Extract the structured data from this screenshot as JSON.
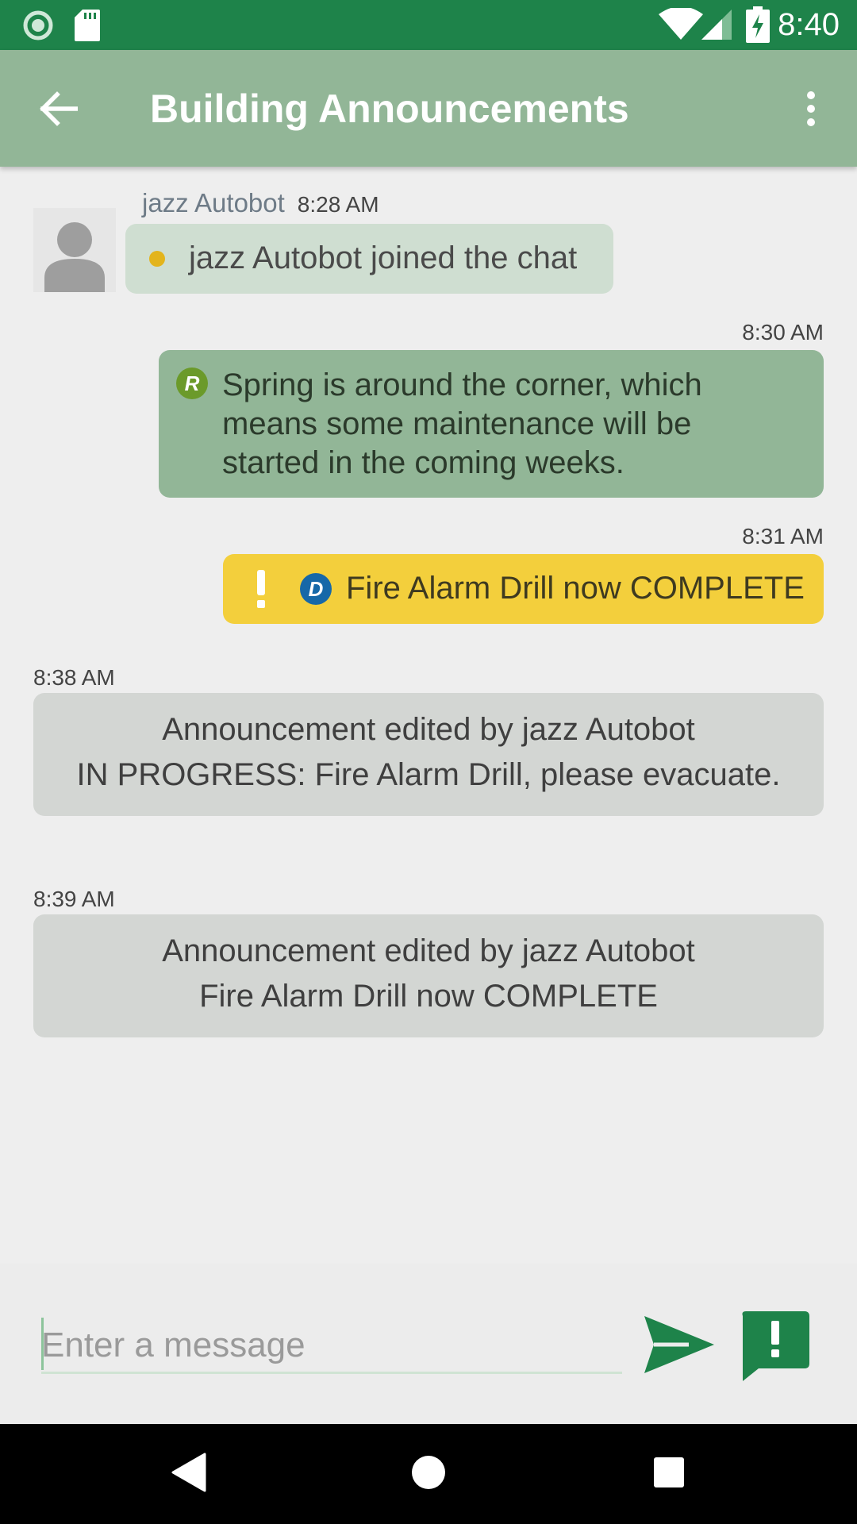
{
  "status_bar": {
    "time": "8:40",
    "icons": [
      "record-icon",
      "sd-card-icon",
      "wifi-icon",
      "cell-signal-icon",
      "battery-charging-icon"
    ]
  },
  "app_bar": {
    "title": "Building Announcements",
    "back_icon": "arrow-left-icon",
    "overflow_icon": "more-vert-icon"
  },
  "messages": [
    {
      "type": "incoming",
      "sender": "jazz Autobot",
      "time": "8:28 AM",
      "text": "jazz Autobot joined the chat",
      "indicator_color": "#e3b41c",
      "avatar_icon": "person-icon"
    },
    {
      "type": "outgoing",
      "time": "8:30 AM",
      "badge": "R",
      "badge_color": "#6b9a2a",
      "text": "Spring is around the corner, which means some maintenance will be started in the coming weeks.",
      "bubble_color": "#92b697"
    },
    {
      "type": "outgoing-alert",
      "time": "8:31 AM",
      "badge": "D",
      "badge_color": "#1668a8",
      "text": "Fire Alarm Drill now COMPLETE",
      "bubble_color": "#f3cf3c"
    },
    {
      "type": "system",
      "time": "8:38 AM",
      "line1": "Announcement edited by jazz Autobot",
      "line2": "IN PROGRESS: Fire Alarm Drill, please evacuate."
    },
    {
      "type": "system",
      "time": "8:39 AM",
      "line1": "Announcement edited by jazz Autobot",
      "line2": "Fire Alarm Drill now COMPLETE"
    }
  ],
  "compose": {
    "placeholder": "Enter a message",
    "value": "",
    "send_icon": "send-icon",
    "alert_icon": "alert-message-icon"
  },
  "nav_bar": {
    "icons": [
      "back-triangle-icon",
      "home-circle-icon",
      "recents-square-icon"
    ]
  },
  "colors": {
    "status_bar": "#1e834a",
    "app_bar": "#92b697",
    "accent_green": "#1e834a",
    "alert_yellow": "#f3cf3c"
  }
}
